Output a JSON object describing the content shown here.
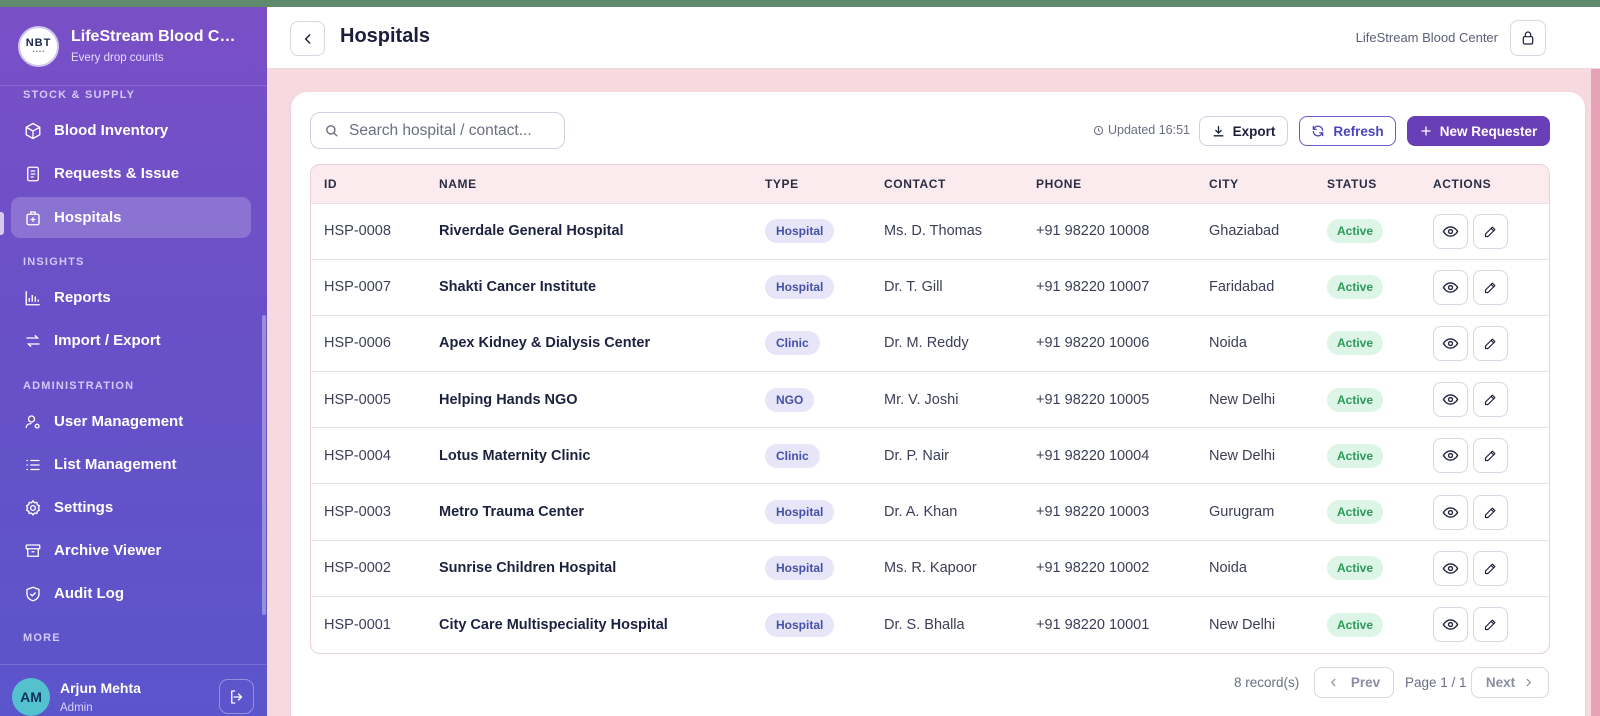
{
  "brand": {
    "name": "LifeStream Blood Center",
    "tagline": "Every drop counts",
    "logo_text": "NBT",
    "logo_subtext": "blood bank"
  },
  "sidebar": {
    "sections": [
      {
        "title": "STOCK & SUPPLY"
      },
      {
        "title": "INSIGHTS"
      },
      {
        "title": "ADMINISTRATION"
      },
      {
        "title": "MORE"
      }
    ],
    "items": [
      {
        "label": "Blood Inventory",
        "icon": "cube-icon"
      },
      {
        "label": "Requests & Issue",
        "icon": "document-icon"
      },
      {
        "label": "Hospitals",
        "icon": "hospital-icon",
        "active": true
      },
      {
        "label": "Reports",
        "icon": "bar-chart-icon"
      },
      {
        "label": "Import / Export",
        "icon": "swap-icon"
      },
      {
        "label": "User Management",
        "icon": "user-gear-icon"
      },
      {
        "label": "List Management",
        "icon": "list-icon"
      },
      {
        "label": "Settings",
        "icon": "gear-icon"
      },
      {
        "label": "Archive Viewer",
        "icon": "archive-icon"
      },
      {
        "label": "Audit Log",
        "icon": "shield-check-icon"
      }
    ],
    "user": {
      "initials": "AM",
      "name": "Arjun Mehta",
      "role": "Admin"
    }
  },
  "header": {
    "title": "Hospitals",
    "org": "LifeStream Blood Center"
  },
  "toolbar": {
    "search_placeholder": "Search hospital / contact...",
    "updated": "Updated 16:51",
    "export_label": "Export",
    "refresh_label": "Refresh",
    "new_label": "New Requester"
  },
  "table": {
    "columns": [
      "ID",
      "NAME",
      "TYPE",
      "CONTACT",
      "PHONE",
      "CITY",
      "STATUS",
      "ACTIONS"
    ],
    "rows": [
      {
        "id": "HSP-0008",
        "name": "Riverdale General Hospital",
        "type": "Hospital",
        "contact": "Ms. D. Thomas",
        "phone": "+91 98220 10008",
        "city": "Ghaziabad",
        "status": "Active"
      },
      {
        "id": "HSP-0007",
        "name": "Shakti Cancer Institute",
        "type": "Hospital",
        "contact": "Dr. T. Gill",
        "phone": "+91 98220 10007",
        "city": "Faridabad",
        "status": "Active"
      },
      {
        "id": "HSP-0006",
        "name": "Apex Kidney & Dialysis Center",
        "type": "Clinic",
        "contact": "Dr. M. Reddy",
        "phone": "+91 98220 10006",
        "city": "Noida",
        "status": "Active"
      },
      {
        "id": "HSP-0005",
        "name": "Helping Hands NGO",
        "type": "NGO",
        "contact": "Mr. V. Joshi",
        "phone": "+91 98220 10005",
        "city": "New Delhi",
        "status": "Active"
      },
      {
        "id": "HSP-0004",
        "name": "Lotus Maternity Clinic",
        "type": "Clinic",
        "contact": "Dr. P. Nair",
        "phone": "+91 98220 10004",
        "city": "New Delhi",
        "status": "Active"
      },
      {
        "id": "HSP-0003",
        "name": "Metro Trauma Center",
        "type": "Hospital",
        "contact": "Dr. A. Khan",
        "phone": "+91 98220 10003",
        "city": "Gurugram",
        "status": "Active"
      },
      {
        "id": "HSP-0002",
        "name": "Sunrise Children Hospital",
        "type": "Hospital",
        "contact": "Ms. R. Kapoor",
        "phone": "+91 98220 10002",
        "city": "Noida",
        "status": "Active"
      },
      {
        "id": "HSP-0001",
        "name": "City Care Multispeciality Hospital",
        "type": "Hospital",
        "contact": "Dr. S. Bhalla",
        "phone": "+91 98220 10001",
        "city": "New Delhi",
        "status": "Active"
      }
    ]
  },
  "pagination": {
    "records": "8 record(s)",
    "prev_label": "Prev",
    "page": "Page 1 / 1",
    "next_label": "Next"
  },
  "colors": {
    "sidebar_top": "#7a4fc6",
    "sidebar_bottom": "#5b55cb",
    "accent": "#6a3eb7",
    "page_bg": "#f7d9e0",
    "status_green": "#2c9a59"
  }
}
